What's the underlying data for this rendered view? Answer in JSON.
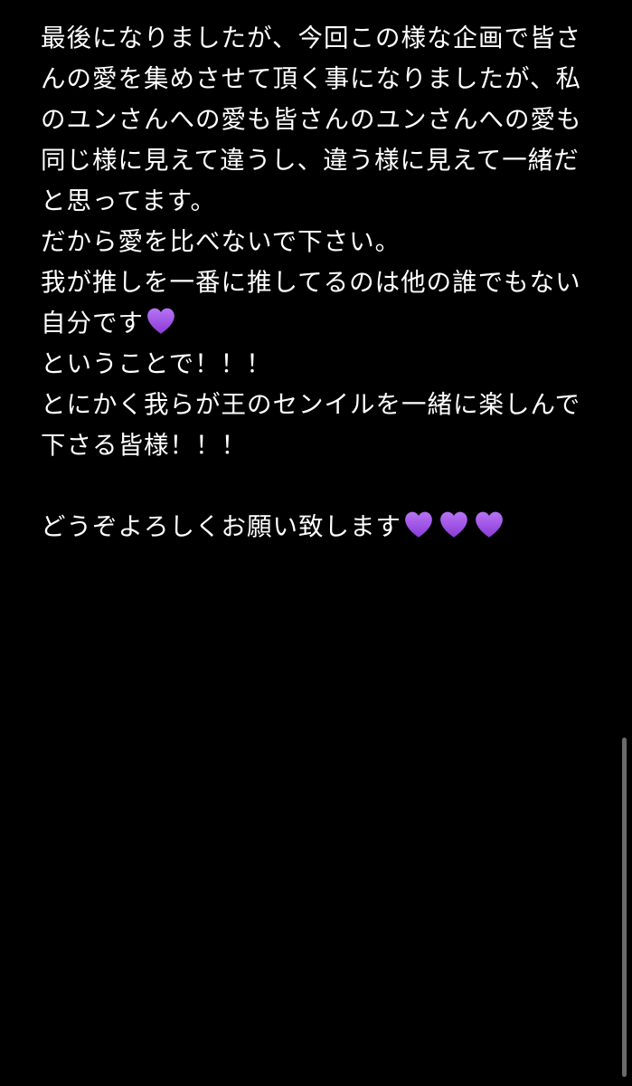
{
  "note": {
    "lines": [
      "最後になりましたが、今回この様な企画で皆さ",
      "んの愛を集めさせて頂く事になりましたが、私",
      "のユンさんへの愛も皆さんのユンさんへの愛も",
      "同じ様に見えて違うし、違う様に見えて一緒だ",
      "と思ってます。",
      "だから愛を比べないで下さい。",
      "我が推しを一番に推してるのは他の誰でもない",
      "自分です",
      "ということで！！！",
      "とにかく我らが王のセンイルを一緒に楽しんで",
      "下さる皆様！！！",
      "",
      "どうぞよろしくお願い致します"
    ]
  },
  "icons": {
    "heart": "purple-heart-icon"
  },
  "colors": {
    "background": "#000000",
    "text": "#ffffff",
    "heart": "#9b4de0",
    "scrollbar": "#6b6b6b"
  }
}
